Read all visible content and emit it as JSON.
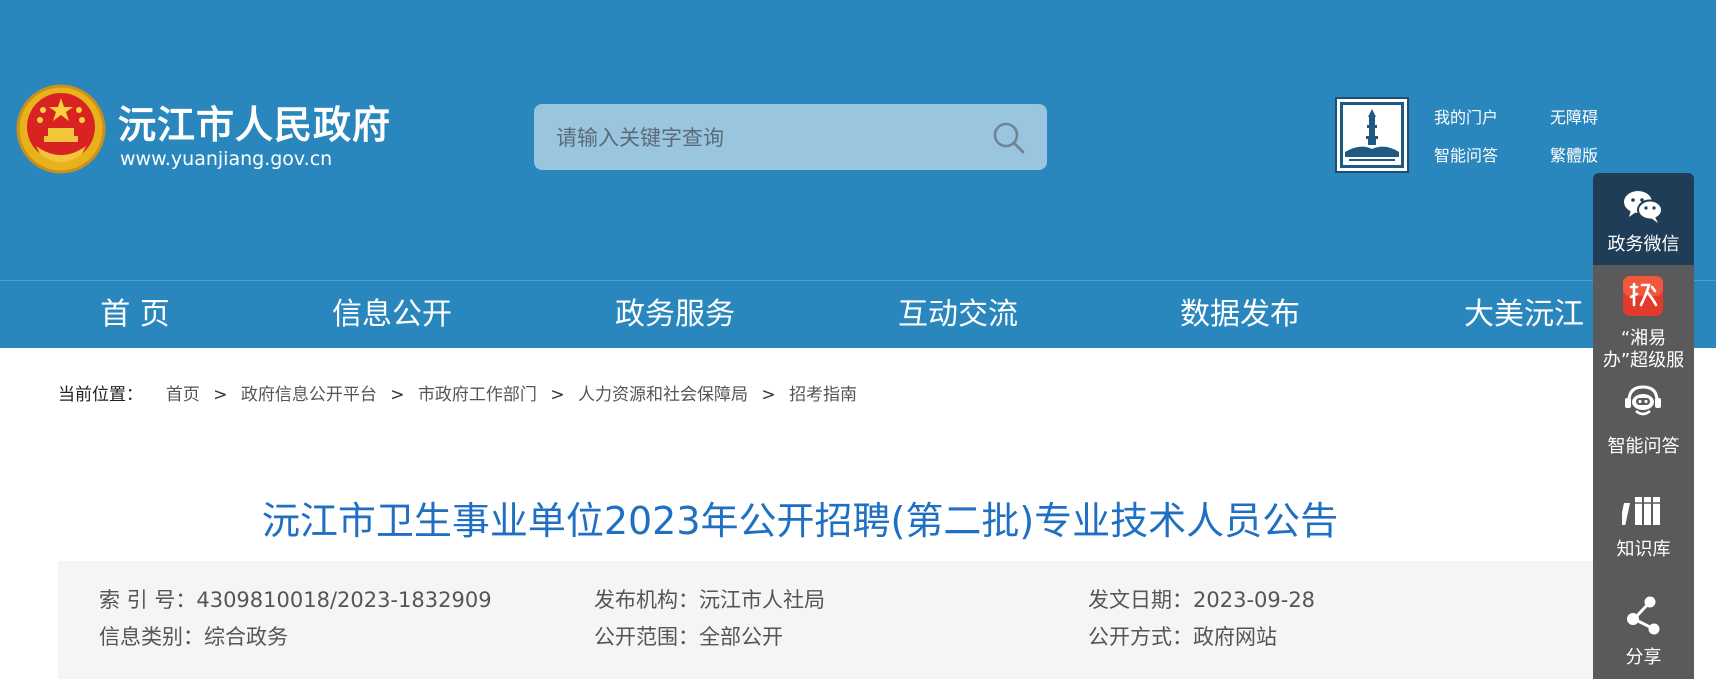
{
  "header": {
    "site_name": "沅江市人民政府",
    "site_url": "www.yuanjiang.gov.cn",
    "search_placeholder": "请输入关键字查询",
    "links": [
      "我的门户",
      "无障碍",
      "智能问答",
      "繁體版"
    ]
  },
  "nav": {
    "items": [
      "首 页",
      "信息公开",
      "政务服务",
      "互动交流",
      "数据发布",
      "大美沅江"
    ]
  },
  "breadcrumb": {
    "label": "当前位置：",
    "items": [
      "首页",
      "政府信息公开平台",
      "市政府工作部门",
      "人力资源和社会保障局",
      "招考指南"
    ],
    "separator": ">"
  },
  "article": {
    "title": "沅江市卫生事业单位2023年公开招聘(第二批)专业技术人员公告",
    "meta": {
      "index_no": "索 引 号：4309810018/2023-1832909",
      "publisher": "发布机构：沅江市人社局",
      "date": "发文日期：2023-09-28",
      "category": "信息类别：综合政务",
      "scope": "公开范围：全部公开",
      "method": "公开方式：政府网站"
    }
  },
  "side_bar": {
    "items": [
      {
        "label": "政务微信",
        "icon": "wechat-icon"
      },
      {
        "label_line1": "“湘易",
        "label_line2": "办”超级服",
        "icon": "xiangyiban-app-icon"
      },
      {
        "label": "智能问答",
        "icon": "robot-icon"
      },
      {
        "label": "知识库",
        "icon": "books-icon"
      },
      {
        "label": "分享",
        "icon": "share-icon"
      }
    ]
  },
  "colors": {
    "header_bg": "#2a87bd",
    "title_blue": "#1f6fc2",
    "side_bar_bg": "#5a5a5a",
    "side_bar_active": "#1f3d57"
  }
}
